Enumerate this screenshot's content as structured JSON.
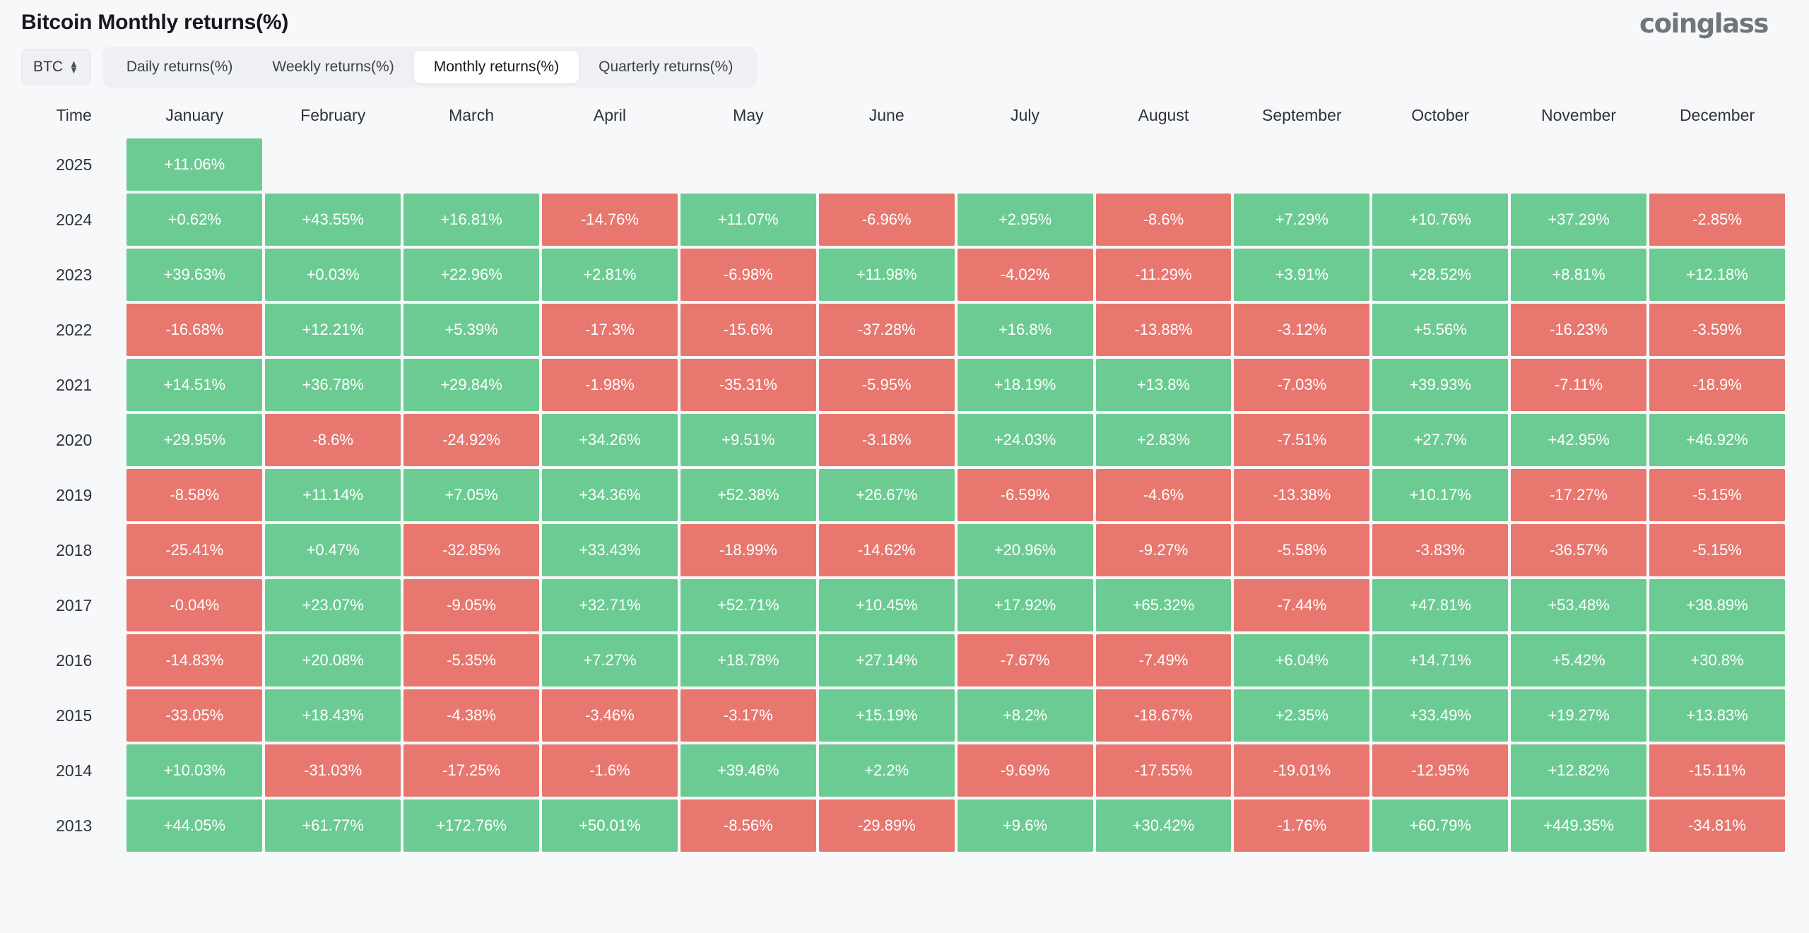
{
  "header": {
    "title": "Bitcoin Monthly returns(%)",
    "brand": "coinglass"
  },
  "controls": {
    "symbol": "BTC",
    "symbol_icon": "updown-chevron-icon",
    "tabs": [
      {
        "label": "Daily returns(%)",
        "active": false
      },
      {
        "label": "Weekly returns(%)",
        "active": false
      },
      {
        "label": "Monthly returns(%)",
        "active": true
      },
      {
        "label": "Quarterly returns(%)",
        "active": false
      }
    ]
  },
  "colors": {
    "positive": "#6ccb93",
    "negative": "#e8776f",
    "background": "#f7f8f9",
    "text": "#2e323a"
  },
  "chart_data": {
    "type": "heatmap",
    "title": "Bitcoin Monthly returns(%)",
    "xlabel": "",
    "ylabel": "Time",
    "columns": [
      "Time",
      "January",
      "February",
      "March",
      "April",
      "May",
      "June",
      "July",
      "August",
      "September",
      "October",
      "November",
      "December"
    ],
    "categories": [
      "January",
      "February",
      "March",
      "April",
      "May",
      "June",
      "July",
      "August",
      "September",
      "October",
      "November",
      "December"
    ],
    "rows": [
      {
        "year": "2025",
        "values": [
          "+11.06%",
          "",
          "",
          "",
          "",
          "",
          "",
          "",
          "",
          "",
          "",
          ""
        ]
      },
      {
        "year": "2024",
        "values": [
          "+0.62%",
          "+43.55%",
          "+16.81%",
          "-14.76%",
          "+11.07%",
          "-6.96%",
          "+2.95%",
          "-8.6%",
          "+7.29%",
          "+10.76%",
          "+37.29%",
          "-2.85%"
        ]
      },
      {
        "year": "2023",
        "values": [
          "+39.63%",
          "+0.03%",
          "+22.96%",
          "+2.81%",
          "-6.98%",
          "+11.98%",
          "-4.02%",
          "-11.29%",
          "+3.91%",
          "+28.52%",
          "+8.81%",
          "+12.18%"
        ]
      },
      {
        "year": "2022",
        "values": [
          "-16.68%",
          "+12.21%",
          "+5.39%",
          "-17.3%",
          "-15.6%",
          "-37.28%",
          "+16.8%",
          "-13.88%",
          "-3.12%",
          "+5.56%",
          "-16.23%",
          "-3.59%"
        ]
      },
      {
        "year": "2021",
        "values": [
          "+14.51%",
          "+36.78%",
          "+29.84%",
          "-1.98%",
          "-35.31%",
          "-5.95%",
          "+18.19%",
          "+13.8%",
          "-7.03%",
          "+39.93%",
          "-7.11%",
          "-18.9%"
        ]
      },
      {
        "year": "2020",
        "values": [
          "+29.95%",
          "-8.6%",
          "-24.92%",
          "+34.26%",
          "+9.51%",
          "-3.18%",
          "+24.03%",
          "+2.83%",
          "-7.51%",
          "+27.7%",
          "+42.95%",
          "+46.92%"
        ]
      },
      {
        "year": "2019",
        "values": [
          "-8.58%",
          "+11.14%",
          "+7.05%",
          "+34.36%",
          "+52.38%",
          "+26.67%",
          "-6.59%",
          "-4.6%",
          "-13.38%",
          "+10.17%",
          "-17.27%",
          "-5.15%"
        ]
      },
      {
        "year": "2018",
        "values": [
          "-25.41%",
          "+0.47%",
          "-32.85%",
          "+33.43%",
          "-18.99%",
          "-14.62%",
          "+20.96%",
          "-9.27%",
          "-5.58%",
          "-3.83%",
          "-36.57%",
          "-5.15%"
        ]
      },
      {
        "year": "2017",
        "values": [
          "-0.04%",
          "+23.07%",
          "-9.05%",
          "+32.71%",
          "+52.71%",
          "+10.45%",
          "+17.92%",
          "+65.32%",
          "-7.44%",
          "+47.81%",
          "+53.48%",
          "+38.89%"
        ]
      },
      {
        "year": "2016",
        "values": [
          "-14.83%",
          "+20.08%",
          "-5.35%",
          "+7.27%",
          "+18.78%",
          "+27.14%",
          "-7.67%",
          "-7.49%",
          "+6.04%",
          "+14.71%",
          "+5.42%",
          "+30.8%"
        ]
      },
      {
        "year": "2015",
        "values": [
          "-33.05%",
          "+18.43%",
          "-4.38%",
          "-3.46%",
          "-3.17%",
          "+15.19%",
          "+8.2%",
          "-18.67%",
          "+2.35%",
          "+33.49%",
          "+19.27%",
          "+13.83%"
        ]
      },
      {
        "year": "2014",
        "values": [
          "+10.03%",
          "-31.03%",
          "-17.25%",
          "-1.6%",
          "+39.46%",
          "+2.2%",
          "-9.69%",
          "-17.55%",
          "-19.01%",
          "-12.95%",
          "+12.82%",
          "-15.11%"
        ]
      },
      {
        "year": "2013",
        "values": [
          "+44.05%",
          "+61.77%",
          "+172.76%",
          "+50.01%",
          "-8.56%",
          "-29.89%",
          "+9.6%",
          "+30.42%",
          "-1.76%",
          "+60.79%",
          "+449.35%",
          "-34.81%"
        ]
      }
    ]
  }
}
